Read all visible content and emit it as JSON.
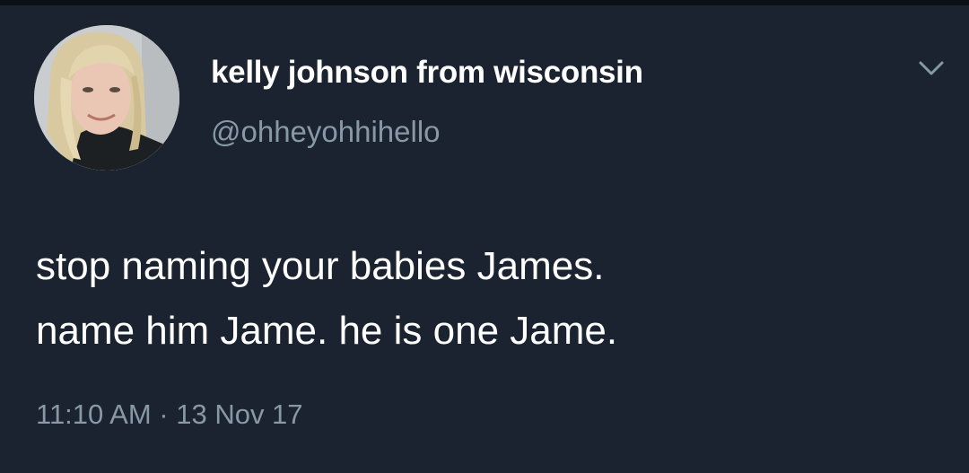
{
  "tweet": {
    "author": {
      "display_name": "kelly johnson from wisconsin",
      "handle": "@ohheyohhihello"
    },
    "text_lines": [
      "stop naming your babies James.",
      "name him Jame. he is one Jame."
    ],
    "timestamp": "11:10 AM · 13 Nov 17",
    "menu_icon": "chevron-down-icon"
  },
  "colors": {
    "background": "#1b2330",
    "text": "#ffffff",
    "secondary_text": "#8899a6"
  }
}
